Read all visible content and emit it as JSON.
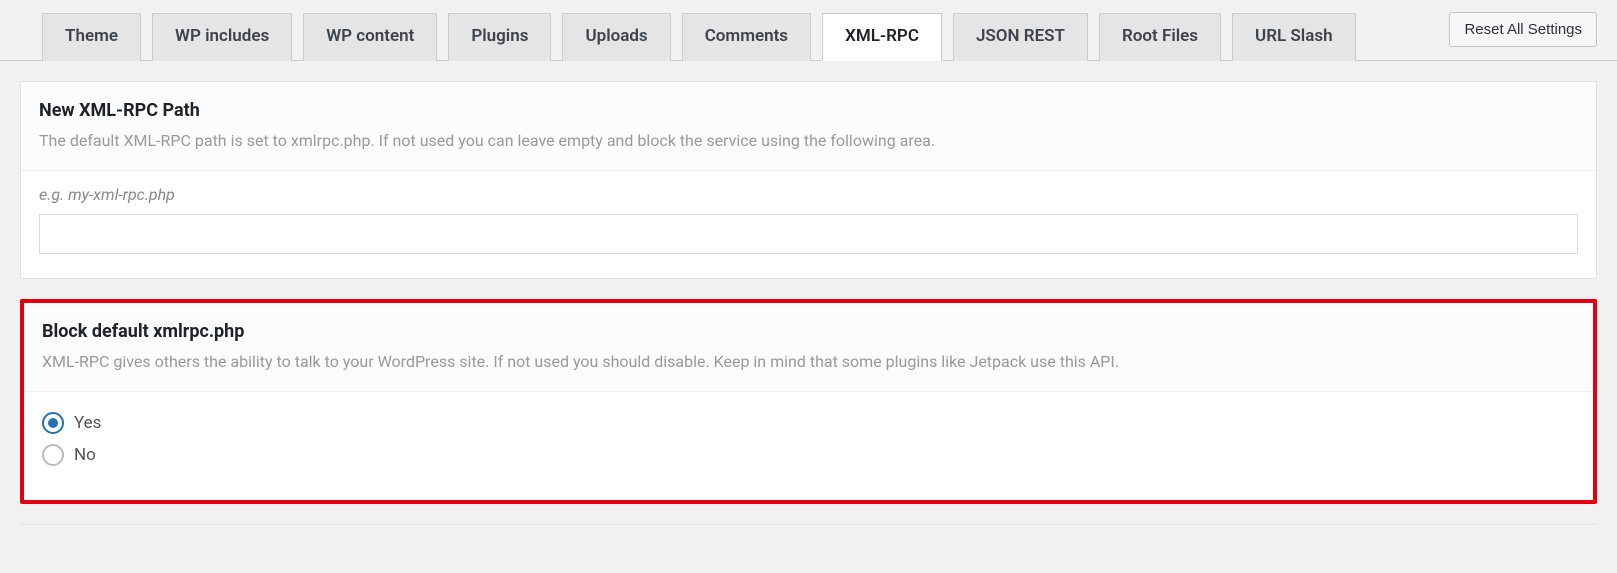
{
  "toolbar": {
    "tabs": [
      {
        "label": "Theme"
      },
      {
        "label": "WP includes"
      },
      {
        "label": "WP content"
      },
      {
        "label": "Plugins"
      },
      {
        "label": "Uploads"
      },
      {
        "label": "Comments"
      },
      {
        "label": "XML-RPC",
        "active": true
      },
      {
        "label": "JSON REST"
      },
      {
        "label": "Root Files"
      },
      {
        "label": "URL Slash"
      }
    ],
    "reset_label": "Reset All Settings"
  },
  "section_path": {
    "title": "New XML-RPC Path",
    "desc": "The default XML-RPC path is set to xmlrpc.php. If not used you can leave empty and block the service using the following area.",
    "hint": "e.g. my-xml-rpc.php",
    "value": ""
  },
  "section_block": {
    "title": "Block default xmlrpc.php",
    "desc": "XML-RPC gives others the ability to talk to your WordPress site. If not used you should disable. Keep in mind that some plugins like Jetpack use this API.",
    "options": {
      "yes": "Yes",
      "no": "No"
    },
    "selected": "yes"
  }
}
